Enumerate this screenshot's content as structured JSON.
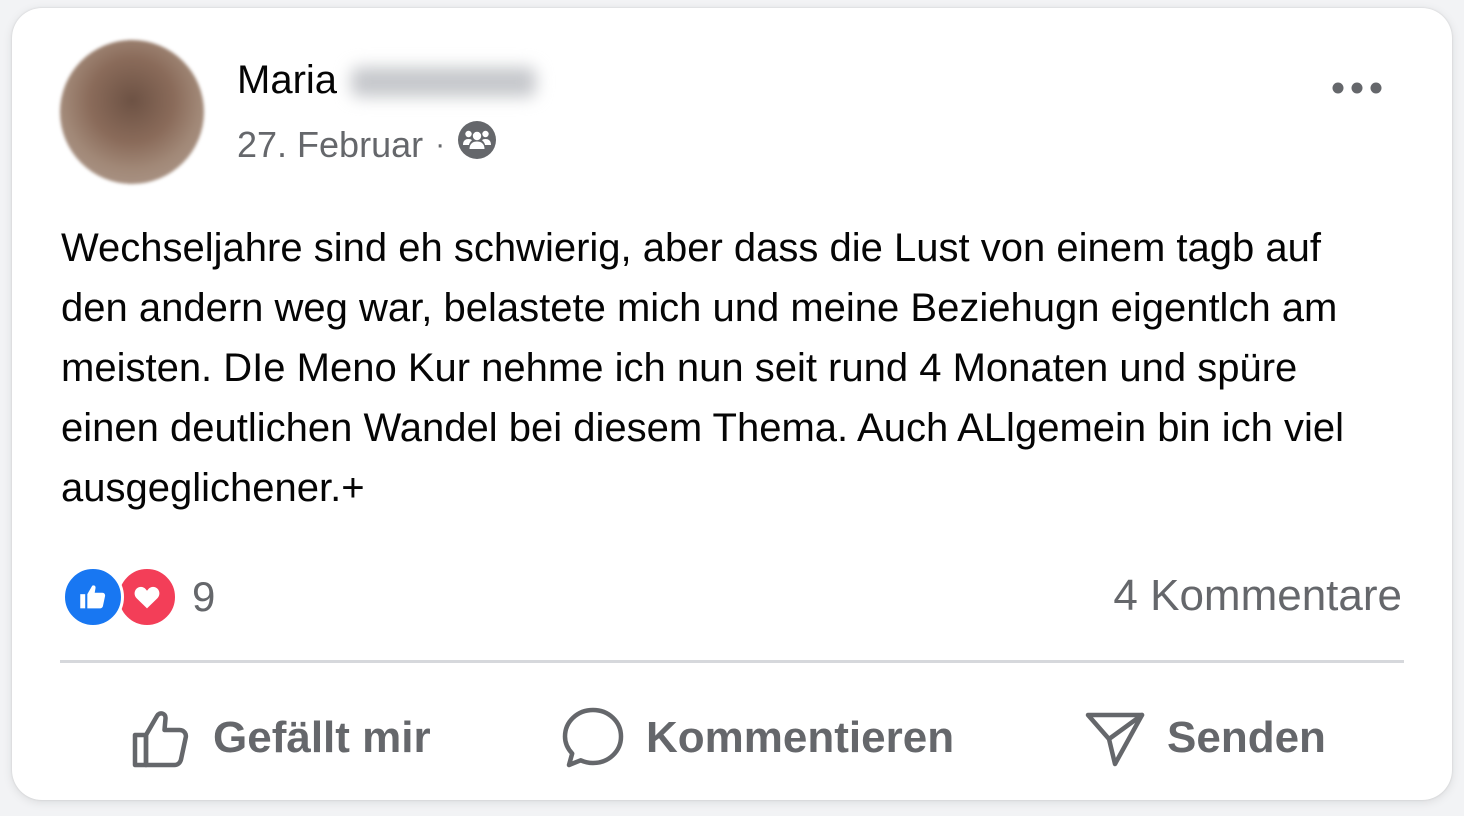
{
  "post": {
    "author_name": "Maria",
    "date": "27. Februar",
    "separator": "·",
    "audience_icon": "friends-icon",
    "more_icon": "more-icon",
    "text": "Wechseljahre sind eh schwierig, aber dass die Lust von einem tagb auf den andern weg war, belastete mich und meine Beziehugn eigentlch am meisten. DIe Meno Kur nehme ich nun seit rund 4 Monaten und spüre einen deutlichen Wandel bei diesem Thema. Auch ALlgemein bin ich viel ausgeglichener.+"
  },
  "stats": {
    "reaction_icons": [
      "like-icon",
      "love-icon"
    ],
    "reaction_count": "9",
    "comments_label": "4 Kommentare"
  },
  "actions": {
    "like_label": "Gefällt mir",
    "comment_label": "Kommentieren",
    "send_label": "Senden"
  },
  "colors": {
    "like_blue": "#1877f2",
    "love_red": "#f33e58",
    "secondary_text": "#65676b",
    "primary_text": "#050505"
  }
}
